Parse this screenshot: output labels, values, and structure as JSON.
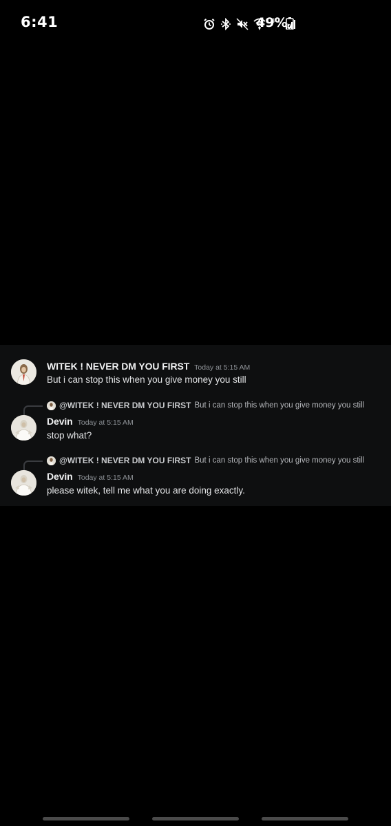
{
  "status_bar": {
    "time": "6:41",
    "network_label": "4G",
    "battery_percent": "49%",
    "icons": [
      "alarm-icon",
      "bluetooth-icon",
      "mute-icon",
      "wifi-icon",
      "signal-icon",
      "battery-icon"
    ]
  },
  "messages": [
    {
      "author": "WITEK ! NEVER DM YOU FIRST",
      "timestamp": "Today at 5:15 AM",
      "text": "But i can stop this when you give money you still"
    },
    {
      "reply_author": "@WITEK ! NEVER DM YOU FIRST",
      "reply_text": "But i can stop this when you give money you still",
      "author": "Devin",
      "timestamp": "Today at 5:15 AM",
      "text": "stop what?"
    },
    {
      "reply_author": "@WITEK ! NEVER DM YOU FIRST",
      "reply_text": "But i can stop this when you give money you still",
      "author": "Devin",
      "timestamp": "Today at 5:15 AM",
      "text": "please witek, tell me what you are doing exactly."
    }
  ],
  "colors": {
    "background": "#000000",
    "panel": "#0e0f10",
    "text": "#e4e5e7",
    "muted": "#8e9297"
  }
}
